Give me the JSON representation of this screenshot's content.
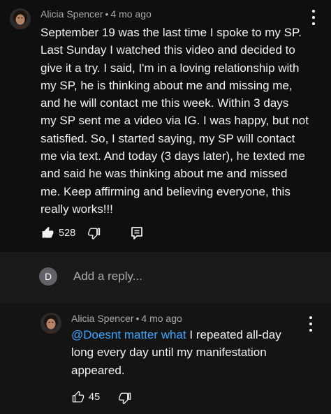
{
  "comment": {
    "author": "Alicia Spencer",
    "separator": "•",
    "time": "4 mo ago",
    "lines": [
      "September 19 was the last time I spoke to my SP.",
      "Last Sunday I watched this video and decided to",
      "give it a try. I said, I'm in a loving relationship with",
      "my SP, he is thinking about me and missing me,",
      "and he will contact me this week. Within 3 days",
      "my SP sent me a video via IG. I was happy, but not",
      "satisfied. So, I started saying, my SP will contact",
      "me via text. And today (3 days later), he texted me",
      "and said he was thinking about me and missed",
      "me. Keep affirming and believing everyone, this",
      "really works!!!"
    ],
    "like_count": "528",
    "liked": true,
    "icons": {
      "like": "thumbs-up-filled-icon",
      "dislike": "thumbs-down-icon",
      "reply": "reply-icon",
      "more": "more-vert-icon"
    }
  },
  "reply_box": {
    "avatar_letter": "D",
    "avatar_color": "#5f6368",
    "placeholder": "Add a reply..."
  },
  "reply": {
    "author": "Alicia Spencer",
    "separator": "•",
    "time": "4 mo ago",
    "mention": "@Doesnt matter what",
    "lines": [
      "I repeated all-day",
      "long every day until my manifestation",
      "appeared."
    ],
    "like_count": "45",
    "liked": false,
    "icons": {
      "like": "thumbs-up-outline-icon",
      "dislike": "thumbs-down-icon",
      "more": "more-vert-icon"
    }
  },
  "colors": {
    "background": "#0f0f0f",
    "reply_box_background": "#1a1a1a",
    "reply_background": "#141414",
    "text_primary": "#f1f1f1",
    "text_secondary": "#aaaaaa",
    "mention": "#3ea6ff"
  }
}
